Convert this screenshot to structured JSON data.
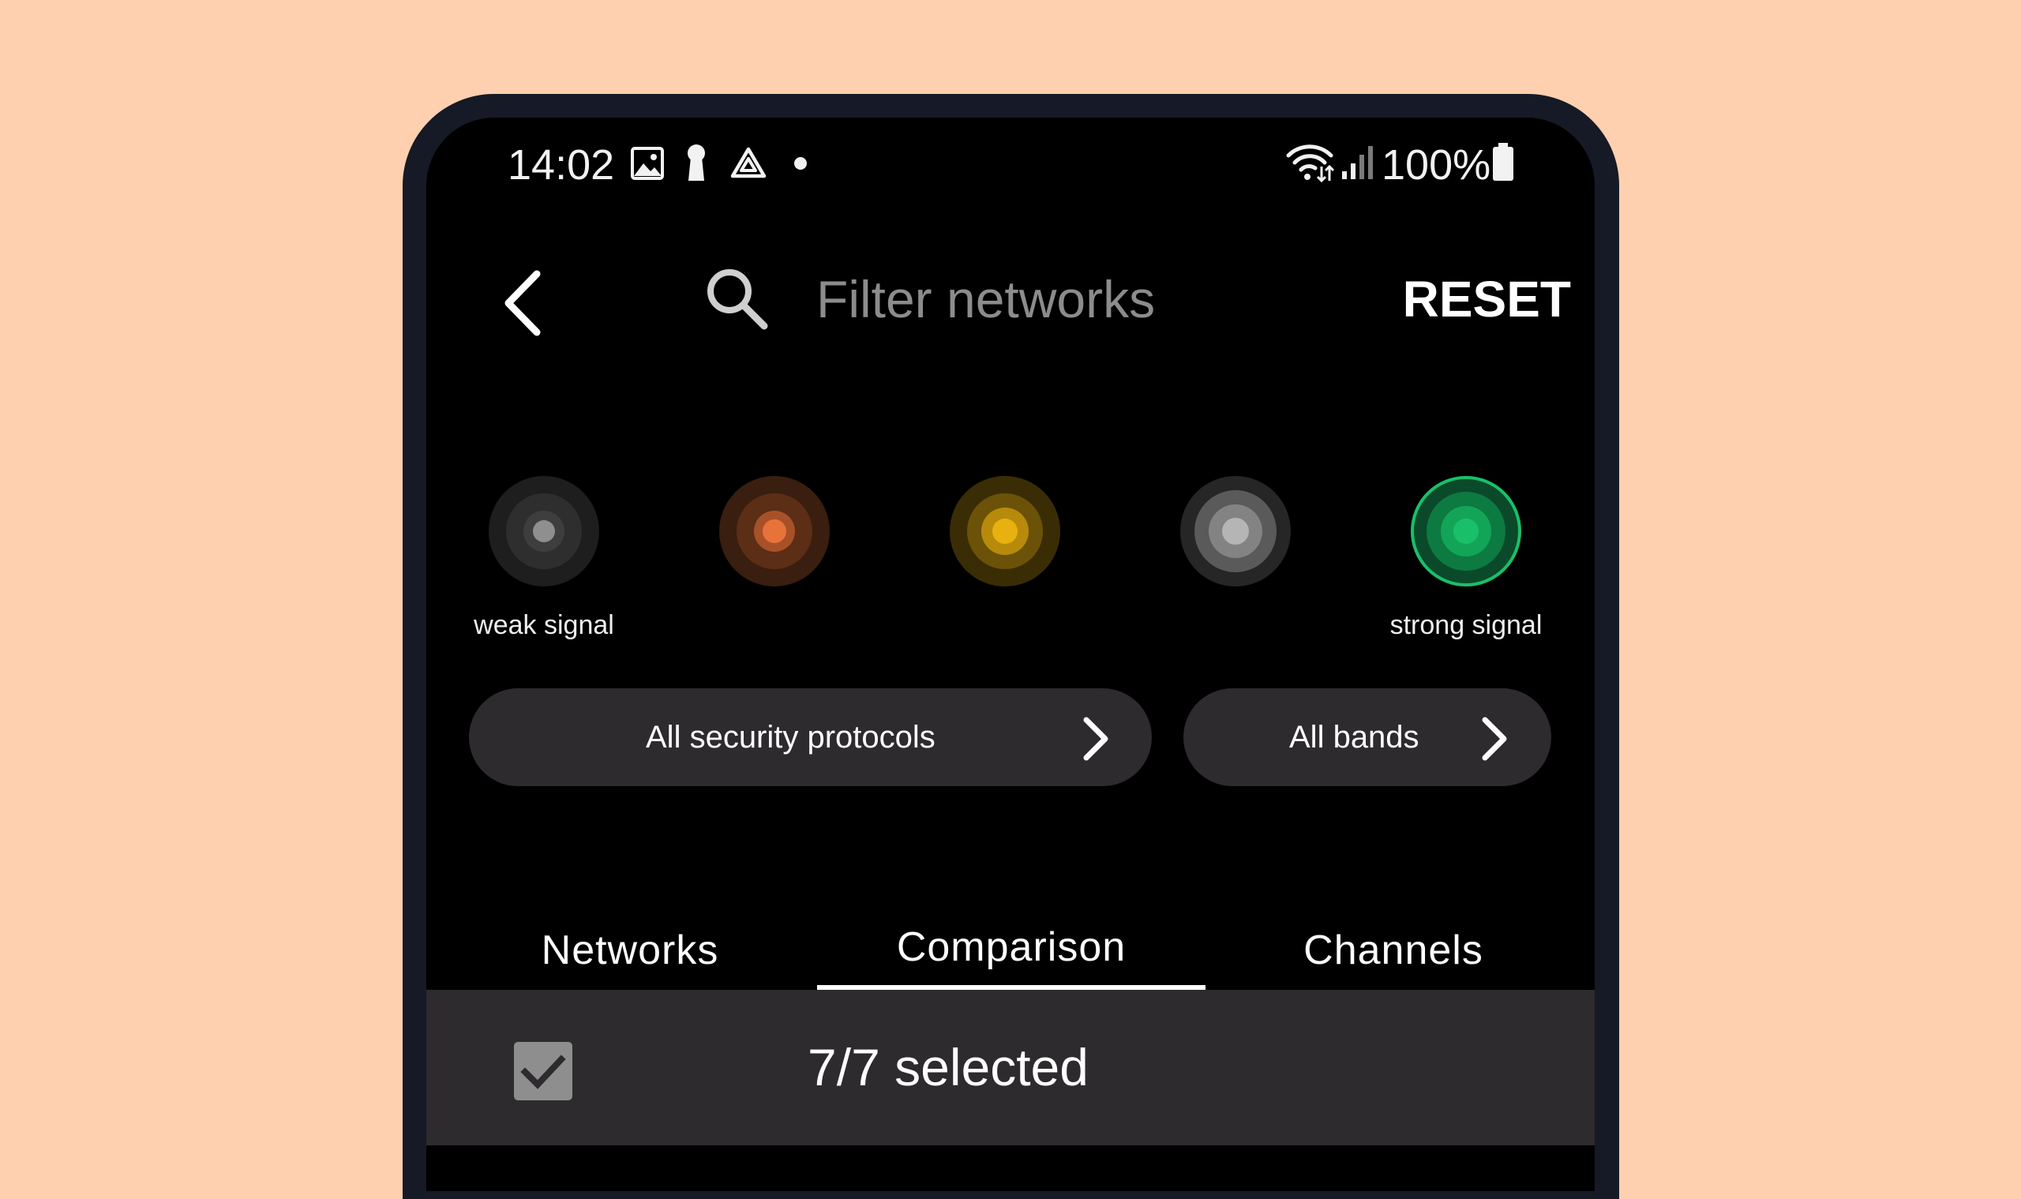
{
  "status_bar": {
    "time": "14:02",
    "battery": "100%",
    "icons": [
      "image-icon",
      "keyhole-icon",
      "drive-icon",
      "dot-icon",
      "wifi-icon",
      "cell-signal-icon",
      "battery-icon"
    ]
  },
  "header": {
    "back_icon": "chevron-left-icon",
    "search_icon": "search-icon",
    "search_placeholder": "Filter networks",
    "reset_label": "RESET"
  },
  "signal_filter": {
    "levels": [
      {
        "name": "weak",
        "color": "#9a9a9a",
        "label": "weak signal"
      },
      {
        "name": "low",
        "color": "#E8733A",
        "label": ""
      },
      {
        "name": "medium",
        "color": "#E8B10F",
        "label": ""
      },
      {
        "name": "good",
        "color": "#b5b5b5",
        "label": ""
      },
      {
        "name": "strong",
        "color": "#1ABF6A",
        "label": "strong signal"
      }
    ],
    "selected": "strong"
  },
  "filters": {
    "security_label": "All security protocols",
    "bands_label": "All bands"
  },
  "tabs": {
    "items": [
      {
        "label": "Networks"
      },
      {
        "label": "Comparison"
      },
      {
        "label": "Channels"
      }
    ],
    "active": "Comparison"
  },
  "selection": {
    "count_text": "7/7 selected",
    "checked": true
  }
}
